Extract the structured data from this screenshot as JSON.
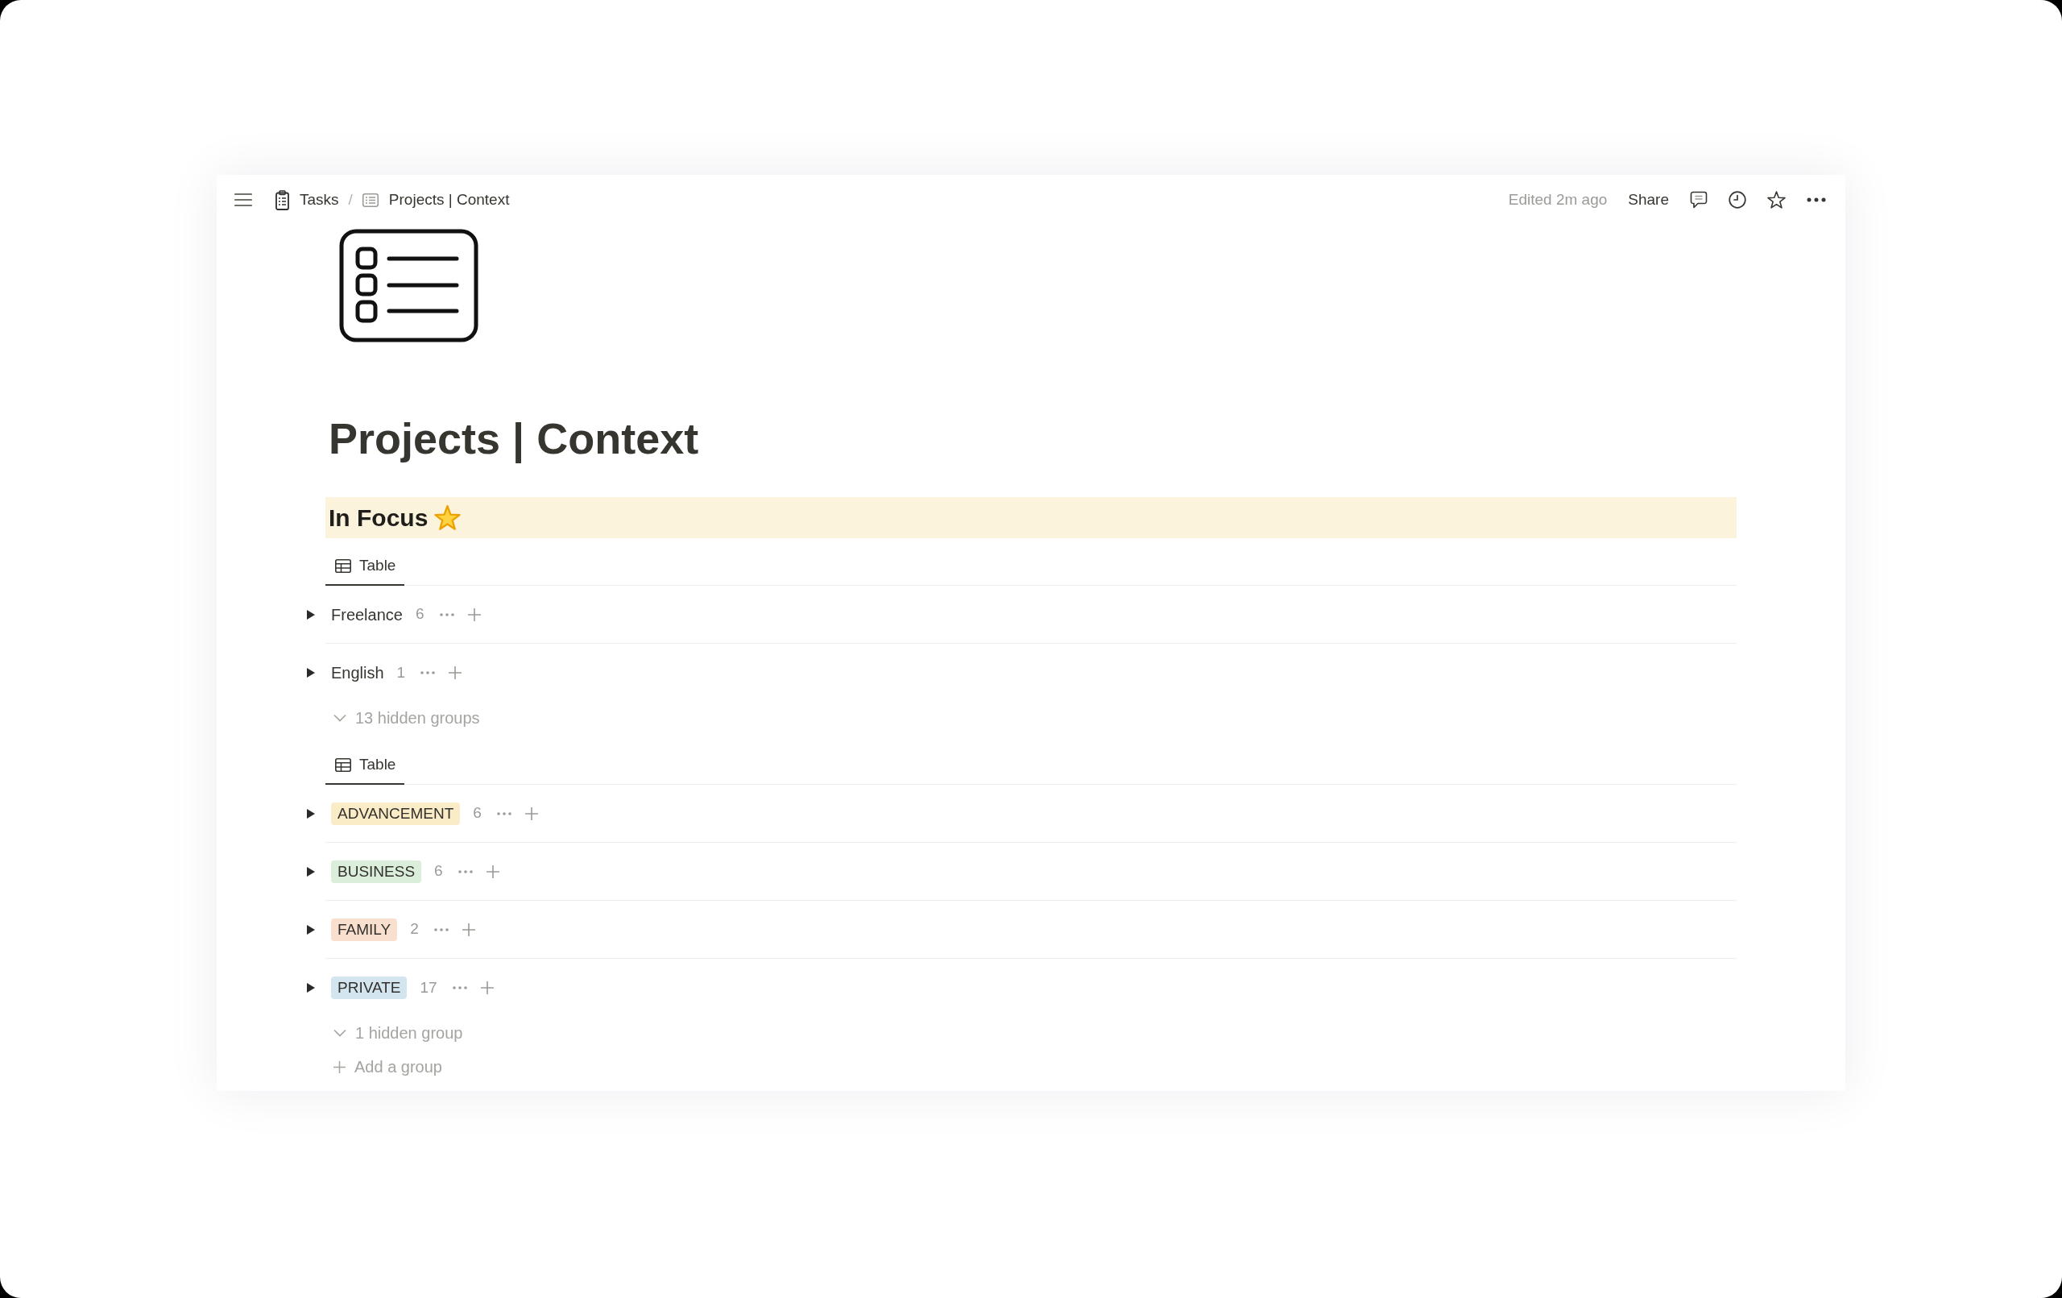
{
  "topbar": {
    "breadcrumbs": [
      {
        "kind": "clipboard",
        "label": "Tasks"
      },
      {
        "kind": "list",
        "label": "Projects | Context"
      }
    ],
    "separator": "/",
    "edited": "Edited 2m ago",
    "share": "Share",
    "favorite": false
  },
  "page": {
    "title": "Projects | Context"
  },
  "heading": {
    "title": "In Focus"
  },
  "views": [
    {
      "tab": {
        "label": "Table",
        "selected": true
      },
      "groups": [
        {
          "kind": "text",
          "label": "Freelance",
          "count": "6",
          "expanded": false
        },
        {
          "kind": "text",
          "label": "English",
          "count": "1",
          "expanded": false
        }
      ],
      "hidden_groups": "13 hidden groups"
    },
    {
      "tab": {
        "label": "Table",
        "selected": true
      },
      "groups": [
        {
          "kind": "tag",
          "label": "ADVANCEMENT",
          "color": "#fbecc8",
          "count": "6",
          "expanded": false
        },
        {
          "kind": "tag",
          "label": "BUSINESS",
          "color": "#dbeddb",
          "count": "6",
          "expanded": false
        },
        {
          "kind": "tag",
          "label": "FAMILY",
          "color": "#f9dfcd",
          "count": "2",
          "expanded": false
        },
        {
          "kind": "tag",
          "label": "PRIVATE",
          "color": "#d3e5ef",
          "count": "17",
          "expanded": false
        }
      ],
      "hidden_groups": "1 hidden group",
      "add_group": "Add a group"
    }
  ]
}
